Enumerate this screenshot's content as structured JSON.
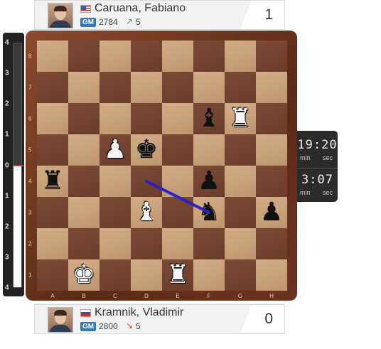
{
  "players": {
    "top": {
      "name": "Caruana, Fabiano",
      "flag": "us-flag-icon",
      "title": "GM",
      "rating": "2784",
      "trend_icon": "↗",
      "trend_value": "5",
      "score": "1"
    },
    "bottom": {
      "name": "Kramnik, Vladimir",
      "flag": "ru-flag-icon",
      "title": "GM",
      "rating": "2800",
      "trend_icon": "↘",
      "trend_value": "5",
      "score": "0"
    }
  },
  "eval_bar": {
    "labels_top": [
      "4",
      "3",
      "2",
      "1",
      "0"
    ],
    "labels_bottom": [
      "1",
      "2",
      "3",
      "4"
    ],
    "value": 0
  },
  "board": {
    "files": [
      "A",
      "B",
      "C",
      "D",
      "E",
      "F",
      "G",
      "H"
    ],
    "ranks": [
      "8",
      "7",
      "6",
      "5",
      "4",
      "3",
      "2",
      "1"
    ],
    "pieces": {
      "f6": {
        "color": "black",
        "type": "bishop",
        "glyph": "♝"
      },
      "g6": {
        "color": "white",
        "type": "rook",
        "glyph": "♜"
      },
      "c5": {
        "color": "white",
        "type": "pawn",
        "glyph": "♟"
      },
      "d5": {
        "color": "black",
        "type": "king",
        "glyph": "♚"
      },
      "a4": {
        "color": "black",
        "type": "rook",
        "glyph": "♜"
      },
      "f4": {
        "color": "black",
        "type": "pawn",
        "glyph": "♟"
      },
      "d3": {
        "color": "white",
        "type": "bishop",
        "glyph": "♝"
      },
      "f3": {
        "color": "black",
        "type": "knight",
        "glyph": "♞"
      },
      "h3": {
        "color": "black",
        "type": "pawn",
        "glyph": "♟"
      },
      "b1": {
        "color": "white",
        "type": "king",
        "glyph": "♚"
      },
      "e1": {
        "color": "white",
        "type": "rook",
        "glyph": "♜"
      }
    },
    "arrow": {
      "from": "d4",
      "to": "f3",
      "color": "#2a22c8"
    }
  },
  "clocks": {
    "top": {
      "time": "19:20",
      "min_label": "min",
      "sec_label": "sec"
    },
    "bottom": {
      "time": "3:07",
      "min_label": "min",
      "sec_label": "sec"
    }
  }
}
